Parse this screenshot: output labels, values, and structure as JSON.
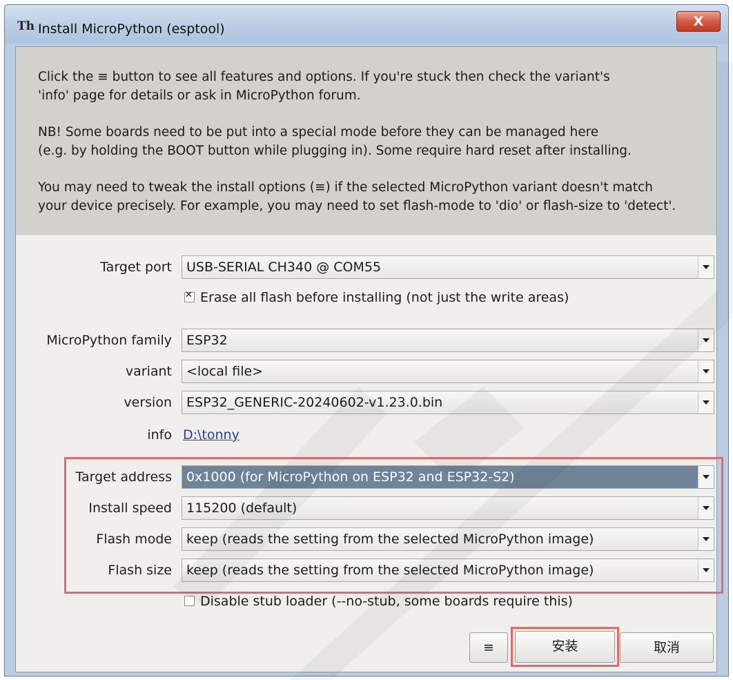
{
  "window": {
    "title": "Install MicroPython (esptool)",
    "close_label": "X",
    "app_icon": "Th"
  },
  "intro": {
    "p1": "Click the ≡ button to see all features and options. If you're stuck then check the variant's\n'info' page for details or ask in MicroPython forum.",
    "p2": "NB! Some boards need to be put into a special mode before they can be managed here\n(e.g. by holding the BOOT button while plugging in). Some require hard reset after installing.",
    "p3": "You may need to tweak the install options (≡) if the selected MicroPython variant doesn't match\nyour device precisely. For example, you may need to set flash-mode to 'dio' or flash-size to 'detect'."
  },
  "form": {
    "target_port": {
      "label": "Target port",
      "value": "USB-SERIAL CH340 @ COM55"
    },
    "erase_flash": {
      "label": "Erase all flash before installing (not just the write areas)",
      "checked": true
    },
    "family": {
      "label": "MicroPython family",
      "value": "ESP32"
    },
    "variant": {
      "label": "variant",
      "value": "<local file>"
    },
    "version": {
      "label": "version",
      "value": "ESP32_GENERIC-20240602-v1.23.0.bin"
    },
    "info": {
      "label": "info",
      "value": "D:\\tonny"
    },
    "target_address": {
      "label": "Target address",
      "value": "0x1000 (for MicroPython on ESP32 and ESP32-S2)"
    },
    "install_speed": {
      "label": "Install speed",
      "value": "115200 (default)"
    },
    "flash_mode": {
      "label": "Flash mode",
      "value": "keep (reads the setting from the selected MicroPython image)"
    },
    "flash_size": {
      "label": "Flash size",
      "value": "keep (reads the setting from the selected MicroPython image)"
    },
    "disable_stub": {
      "label": "Disable stub loader (--no-stub, some boards require this)",
      "checked": false
    }
  },
  "buttons": {
    "menu": "≡",
    "install": "安装",
    "cancel": "取消"
  },
  "colors": {
    "highlight_box": "#e46a6a",
    "selected_combo": "#6f8399",
    "link": "#1f3fb0"
  }
}
